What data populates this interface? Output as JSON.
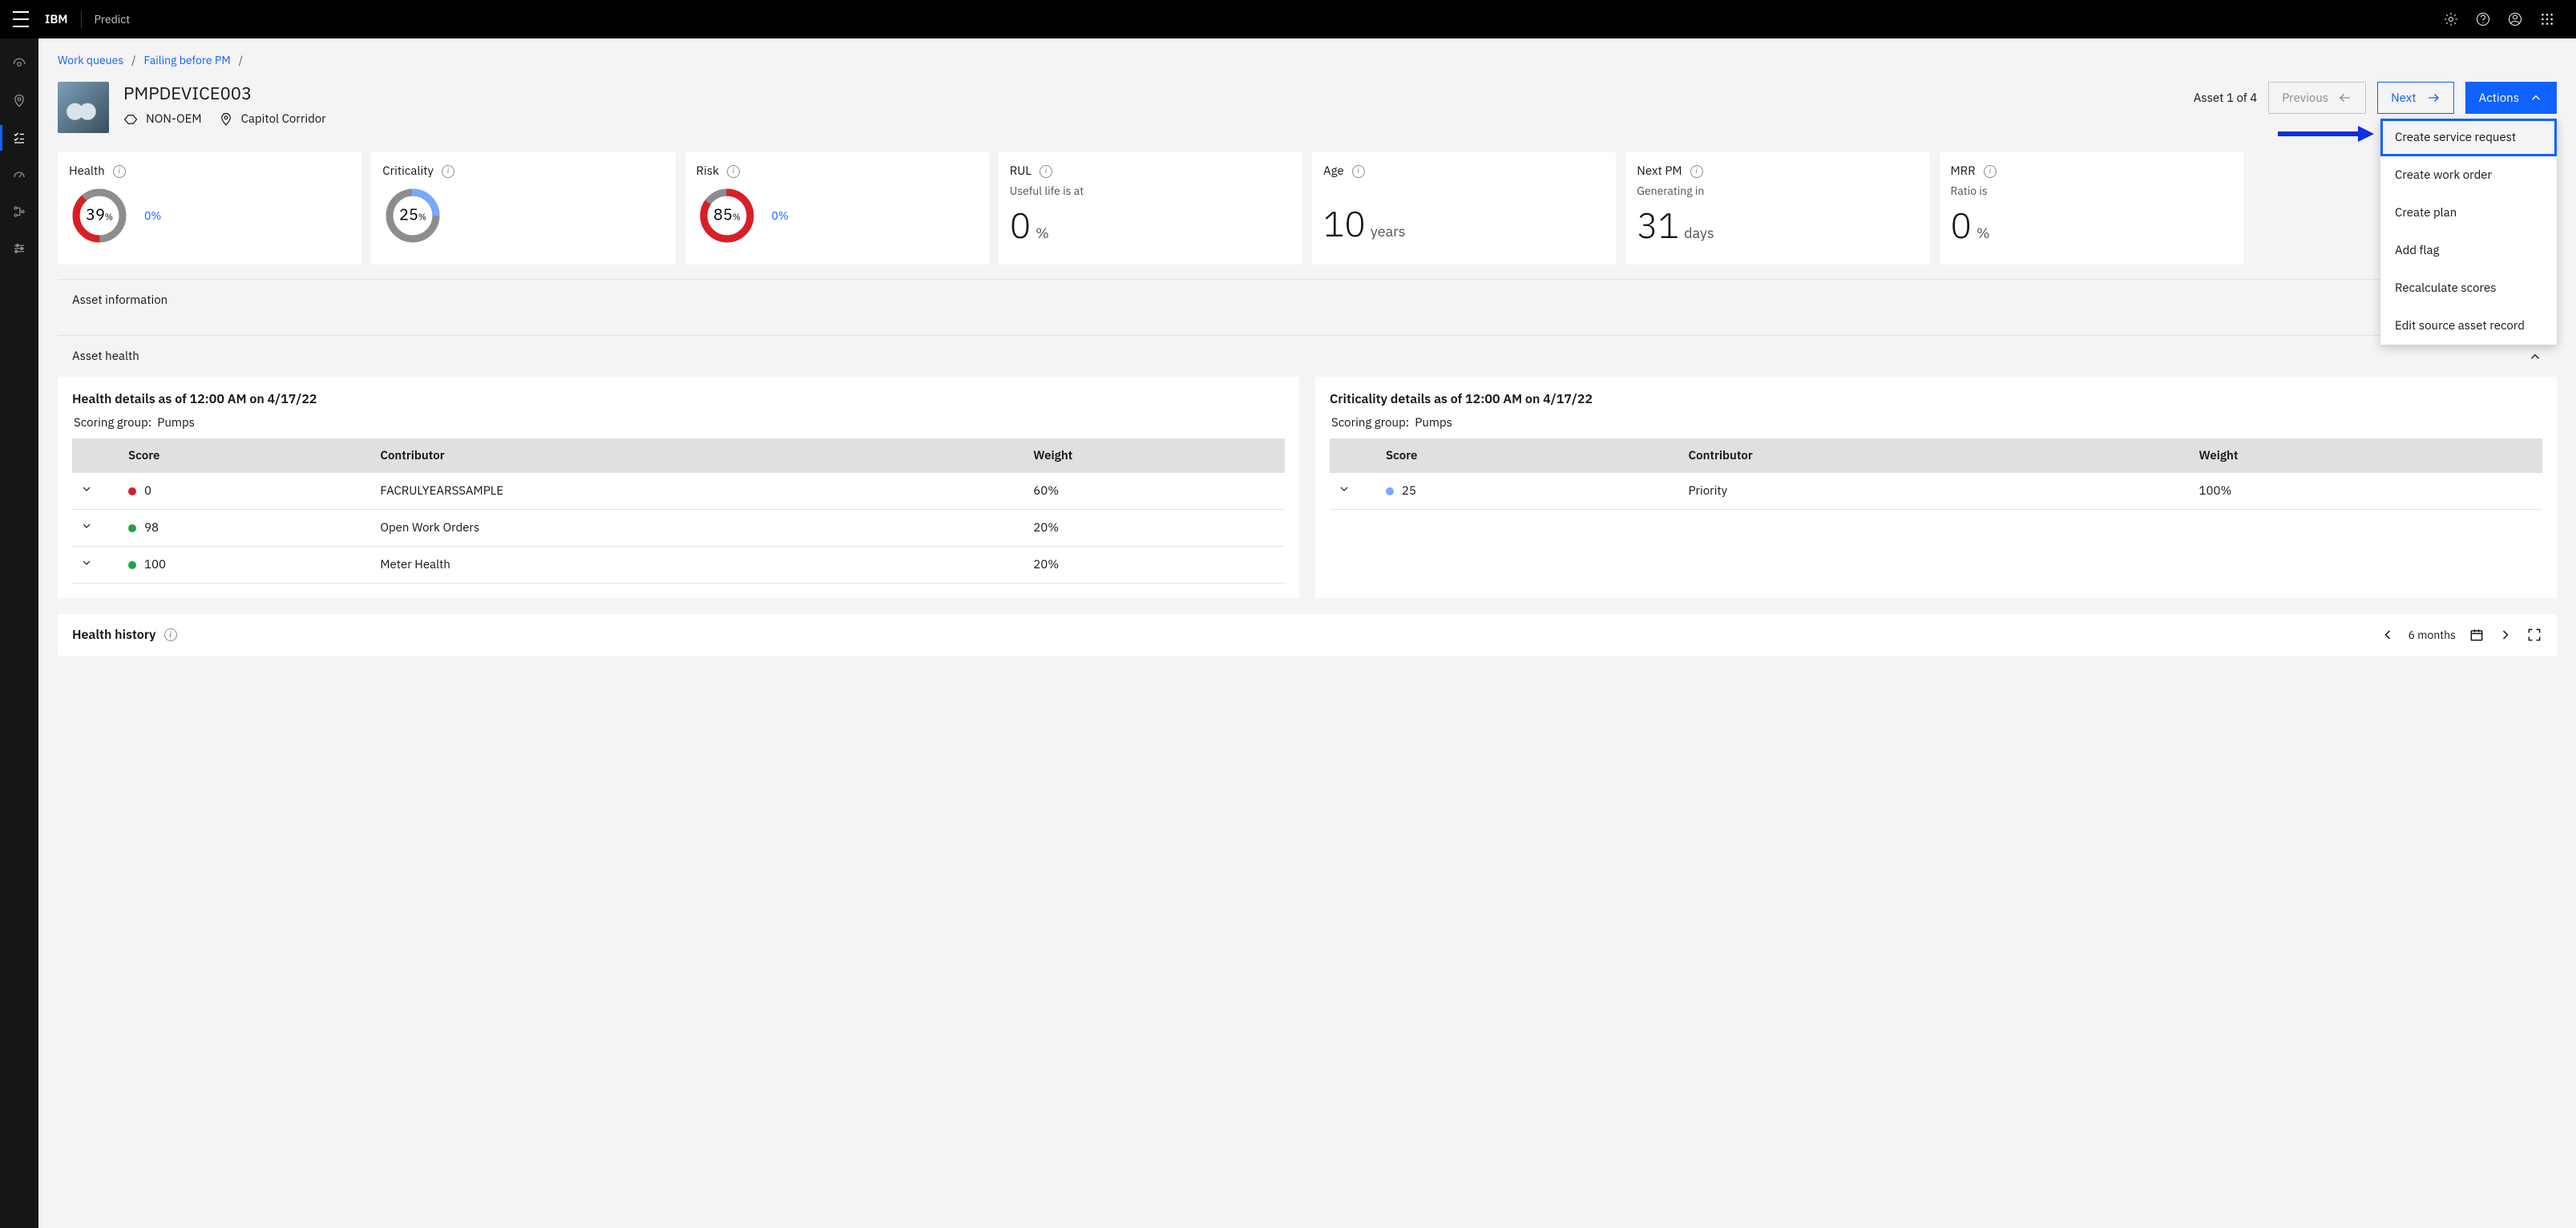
{
  "topbar": {
    "brand": "IBM",
    "app": "Predict"
  },
  "breadcrumb": {
    "a": "Work queues",
    "b": "Failing before PM"
  },
  "asset": {
    "id": "PMPDEVICE003",
    "oem": "NON-OEM",
    "location": "Capitol Corridor",
    "counter": "Asset 1 of 4",
    "prev": "Previous",
    "next": "Next",
    "actions": "Actions"
  },
  "actions_menu": {
    "create_sr": "Create service request",
    "create_wo": "Create work order",
    "create_plan": "Create plan",
    "add_flag": "Add flag",
    "recalc": "Recalculate scores",
    "edit_src": "Edit source asset record"
  },
  "kpis": {
    "health": {
      "label": "Health",
      "value": 39,
      "pct": "0%",
      "color": "#da1e28"
    },
    "crit": {
      "label": "Criticality",
      "value": 25,
      "color": "#78a9ff"
    },
    "risk": {
      "label": "Risk",
      "value": 85,
      "pct": "0%",
      "color": "#da1e28"
    },
    "rul": {
      "label": "RUL",
      "sub": "Useful life is at",
      "num": "0",
      "unit": "%"
    },
    "age": {
      "label": "Age",
      "num": "10",
      "unit": "years"
    },
    "nextpm": {
      "label": "Next PM",
      "sub": "Generating in",
      "num": "31",
      "unit": "days"
    },
    "mrr": {
      "label": "MRR",
      "sub": "Ratio is",
      "num": "0",
      "unit": "%"
    }
  },
  "sections": {
    "info": "Asset information",
    "health": "Asset health"
  },
  "health_panel": {
    "title": "Health details as of 12:00 AM on 4/17/22",
    "scoring_label": "Scoring group:",
    "scoring_value": "Pumps",
    "cols": {
      "score": "Score",
      "contrib": "Contributor",
      "weight": "Weight"
    },
    "rows": [
      {
        "dot": "red",
        "score": "0",
        "contrib": "FACRULYEARSSAMPLE",
        "weight": "60%"
      },
      {
        "dot": "green",
        "score": "98",
        "contrib": "Open Work Orders",
        "weight": "20%"
      },
      {
        "dot": "green",
        "score": "100",
        "contrib": "Meter Health",
        "weight": "20%"
      }
    ]
  },
  "crit_panel": {
    "title": "Criticality details as of 12:00 AM on 4/17/22",
    "scoring_label": "Scoring group:",
    "scoring_value": "Pumps",
    "cols": {
      "score": "Score",
      "contrib": "Contributor",
      "weight": "Weight"
    },
    "rows": [
      {
        "dot": "blue",
        "score": "25",
        "contrib": "Priority",
        "weight": "100%"
      }
    ]
  },
  "hh": {
    "title": "Health history",
    "range": "6 months"
  }
}
